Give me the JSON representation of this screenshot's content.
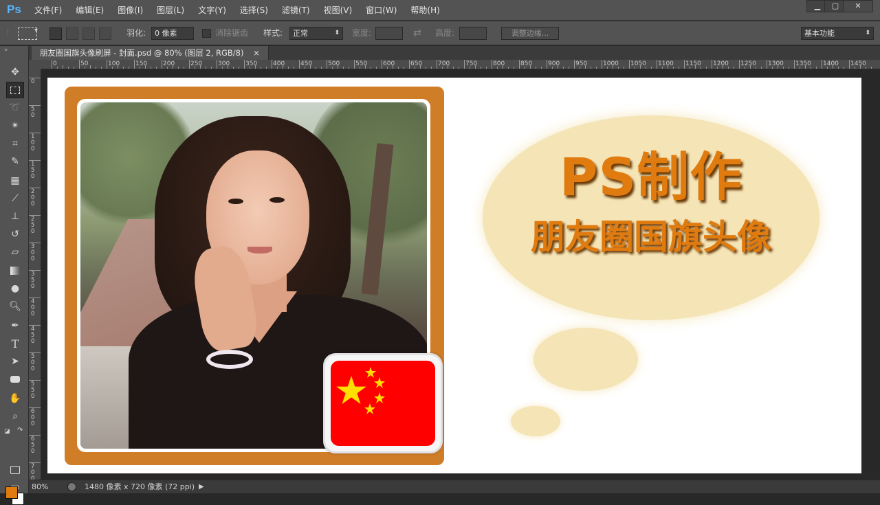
{
  "app": {
    "logo": "Ps",
    "menu": [
      "文件(F)",
      "编辑(E)",
      "图像(I)",
      "图层(L)",
      "文字(Y)",
      "选择(S)",
      "滤镜(T)",
      "视图(V)",
      "窗口(W)",
      "帮助(H)"
    ],
    "window_controls": {
      "minimize": "▁",
      "maximize": "▢",
      "close": "✕"
    }
  },
  "options": {
    "feather_label": "羽化:",
    "feather_value": "0 像素",
    "antialias_label": "消除锯齿",
    "style_label": "样式:",
    "style_value": "正常",
    "width_label": "宽度:",
    "height_label": "高度:",
    "refine_edge_label": "调整边缘...",
    "workspace_value": "基本功能"
  },
  "document": {
    "tab_title": "朋友圈国旗头像刷屏 - 封面.psd @ 80% (图层 2, RGB/8)",
    "tab_close": "×"
  },
  "ruler": {
    "h_labels": [
      "0",
      "50",
      "100",
      "150",
      "200",
      "250",
      "300",
      "350",
      "400",
      "450",
      "500",
      "550",
      "600",
      "650",
      "700",
      "750",
      "800",
      "850",
      "900",
      "950",
      "1000",
      "1050",
      "1100",
      "1150",
      "1200",
      "1250",
      "1300",
      "1350",
      "1400",
      "1450"
    ],
    "v_labels": [
      "0",
      "5\n0",
      "1\n0\n0",
      "1\n5\n0",
      "2\n0\n0",
      "2\n5\n0",
      "3\n0\n0",
      "3\n5\n0",
      "4\n0\n0",
      "4\n5\n0",
      "5\n0\n0",
      "5\n5\n0",
      "6\n0\n0",
      "6\n5\n0",
      "7\n0\n0"
    ]
  },
  "canvas": {
    "title_line1": "PS制作",
    "title_line2": "朋友圈国旗头像",
    "colors": {
      "frame": "#d07d28",
      "bubble": "#f4e4b6",
      "title": "#e07b10",
      "flag_red": "#ff0000",
      "flag_star": "#ffde00"
    }
  },
  "status": {
    "zoom": "80%",
    "doc_info": "1480 像素 x 720 像素 (72 ppi)",
    "arrow": "▶"
  },
  "tools": [
    "move-tool-icon",
    "marquee-tool-icon",
    "lasso-tool-icon",
    "magic-wand-icon",
    "crop-tool-icon",
    "eyedropper-icon",
    "healing-brush-icon",
    "brush-tool-icon",
    "clone-stamp-icon",
    "history-brush-icon",
    "eraser-icon",
    "gradient-tool-icon",
    "blur-tool-icon",
    "dodge-tool-icon",
    "pen-tool-icon",
    "type-tool-icon",
    "path-selection-icon",
    "shape-tool-icon",
    "hand-tool-icon",
    "zoom-tool-icon"
  ]
}
